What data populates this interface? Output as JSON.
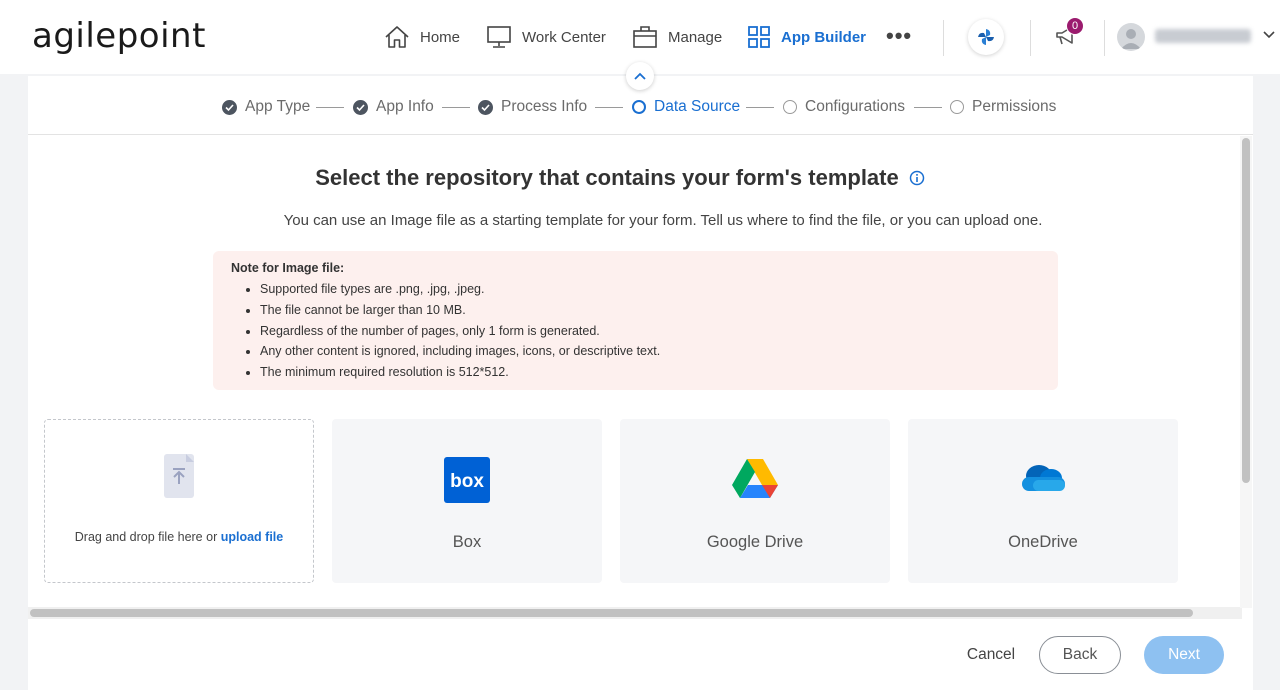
{
  "header": {
    "logo_text": "agilepoint",
    "nav": [
      {
        "label": "Home",
        "icon": "home-icon"
      },
      {
        "label": "Work Center",
        "icon": "monitor-icon"
      },
      {
        "label": "Manage",
        "icon": "briefcase-icon"
      },
      {
        "label": "App Builder",
        "icon": "grid-icon",
        "active": true
      }
    ],
    "more_label": "•••",
    "notification_count": "0",
    "accent_color": "#1a6fd1"
  },
  "steps": [
    {
      "label": "App Type",
      "state": "done"
    },
    {
      "label": "App Info",
      "state": "done"
    },
    {
      "label": "Process Info",
      "state": "done"
    },
    {
      "label": "Data Source",
      "state": "current"
    },
    {
      "label": "Configurations",
      "state": "todo"
    },
    {
      "label": "Permissions",
      "state": "todo"
    }
  ],
  "main": {
    "heading": "Select the repository that contains your form's template",
    "subtext": "You can use an Image file as a starting template for your form. Tell us where to find the file, or you can upload one.",
    "note": {
      "title": "Note for Image file:",
      "items": [
        "Supported file types are .png, .jpg, .jpeg.",
        "The file cannot be larger than 10 MB.",
        "Regardless of the number of pages, only 1 form is generated.",
        "Any other content is ignored, including images, icons, or descriptive text.",
        "The minimum required resolution is 512*512."
      ]
    },
    "upload": {
      "text": "Drag and drop file here or",
      "link": "upload file"
    },
    "sources": [
      {
        "label": "Box",
        "icon": "box-logo-icon",
        "icon_text": "box"
      },
      {
        "label": "Google Drive",
        "icon": "google-drive-icon"
      },
      {
        "label": "OneDrive",
        "icon": "onedrive-icon"
      }
    ]
  },
  "footer": {
    "cancel": "Cancel",
    "back": "Back",
    "next": "Next"
  }
}
